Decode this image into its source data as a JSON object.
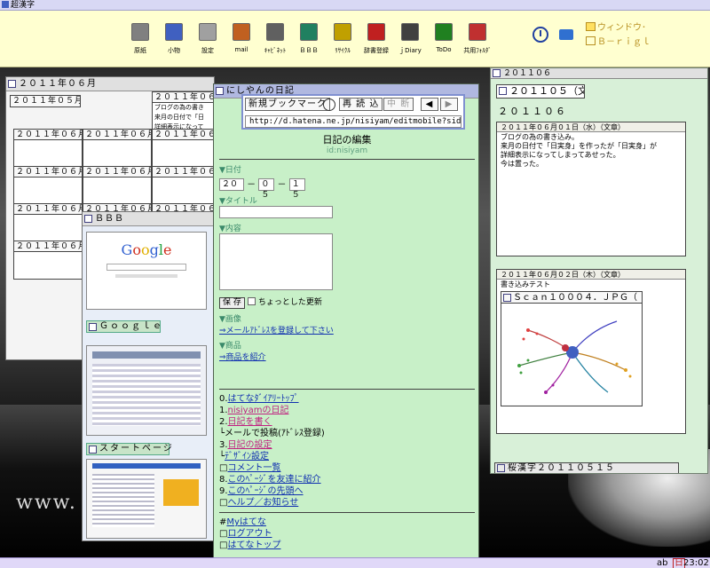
{
  "app": {
    "title": "超漢字"
  },
  "toolbar": {
    "items": [
      {
        "label": "原紙",
        "icon": "printer-icon",
        "color": "#808080"
      },
      {
        "label": "小物",
        "icon": "tools-icon",
        "color": "#4060c0"
      },
      {
        "label": "設定",
        "icon": "settings-icon",
        "color": "#a0a0a0"
      },
      {
        "label": "mail",
        "icon": "mail-icon",
        "color": "#c06020"
      },
      {
        "label": "ｷｬﾋﾞﾈｯﾄ",
        "icon": "cabinet-icon",
        "color": "#606060"
      },
      {
        "label": "ＢＢＢ",
        "icon": "bbb-icon",
        "color": "#208060"
      },
      {
        "label": "ﾘｻｲｸﾙ",
        "icon": "recycle-icon",
        "color": "#c0a000"
      },
      {
        "label": "辞書登録",
        "icon": "dictionary-icon",
        "color": "#c02020"
      },
      {
        "label": "ｊDiary",
        "icon": "diary-icon",
        "color": "#404040"
      },
      {
        "label": "ToDo",
        "icon": "todo-icon",
        "color": "#208020"
      },
      {
        "label": "共用ﾌｫﾙﾀﾞ",
        "icon": "shared-folder-icon",
        "color": "#c03030"
      }
    ],
    "window_label": "ウィンドウ･",
    "bright_label": "Ｂ－ｒｉｇｌ"
  },
  "calendar": {
    "title": "２０１１年０６月",
    "sub_title": "２０１１年０５月",
    "cells": [
      [
        "２０１１年０６月０",
        "ブログの為の書き",
        "来月の日付で「日",
        "詳細表示になって"
      ],
      [
        "２０１１年０６月０６"
      ],
      [
        "２０１１年０６月０７"
      ],
      [
        "２０１１年０６月０８"
      ],
      [
        "２０１１年０６月１３"
      ],
      [
        "２０１１年０６月１４"
      ],
      [
        "２０１１年０６月１５"
      ],
      [
        "２０１１年０６月２０"
      ],
      [
        "２０１１年０６月２１"
      ],
      [
        "２０１１年０６月２２"
      ],
      [
        "２０１１年０６月２７"
      ]
    ]
  },
  "bbb": {
    "title": "ＢＢＢ",
    "google_label": "Ｇｏｏｇｌｅ",
    "startpage_label": "スタートページ",
    "google_logo": "Google"
  },
  "bookmark": {
    "new_bookmark": "新規ブックマーク",
    "reload": "再 読 込",
    "stop": "中 断",
    "url": "http://d.hatena.ne.jp/nisiyam/editmobile?sid=21"
  },
  "diary": {
    "title": "にしやんの日記",
    "heading": "日記の編集",
    "user_id": "id:nisiyam",
    "date_label": "▼日付",
    "year": "２０",
    "month": "０５",
    "day": "１５",
    "title_label": "▼タイトル",
    "content_label": "▼内容",
    "save": "保 存",
    "small_update": "ちょっとした更新",
    "image_label": "▼画像",
    "mail_register": "⇒メールｱﾄﾞﾚｽを登録して下さい",
    "product_label": "▼商品",
    "product_intro": "⇒商品を紹介",
    "menu": [
      {
        "prefix": "0.",
        "text": "はてなﾀﾞｲｱﾘｰﾄｯﾌﾟ",
        "style": "lnk"
      },
      {
        "prefix": "1.",
        "text": "nisiyamの日記",
        "style": "pink"
      },
      {
        "prefix": "2.",
        "text": "日記を書く",
        "style": "pink"
      },
      {
        "prefix": "└",
        "text": "メールで投稿(ｱﾄﾞﾚｽ登録)",
        "style": "plain"
      },
      {
        "prefix": "3.",
        "text": "日記の設定",
        "style": "pink"
      },
      {
        "prefix": "└",
        "text": "ﾃﾞｻﾞｲﾝ設定",
        "style": "lnk"
      },
      {
        "prefix": "□",
        "text": "コメント一覧",
        "style": "lnk"
      },
      {
        "prefix": "8.",
        "text": "このﾍﾟｰｼﾞを友達に紹介",
        "style": "lnk"
      },
      {
        "prefix": "9.",
        "text": "このﾍﾟｰｼﾞの先頭へ",
        "style": "lnk"
      },
      {
        "prefix": "□",
        "text": "ヘルプ／お知らせ",
        "style": "lnk"
      }
    ],
    "footer": [
      {
        "prefix": "#",
        "text": "Myはてな"
      },
      {
        "prefix": "□",
        "text": "ログアウト"
      },
      {
        "prefix": "□",
        "text": "はてなトップ"
      }
    ]
  },
  "right_panel": {
    "header": "２０１１０６",
    "folder_label": "２０１１０５（文",
    "sub_label": "２０１１０６",
    "entry1_title": "２０１１年０６月０１日（水）（文章）",
    "entry1_lines": [
      "ブログの為の書き込み。",
      "来月の日付で「日実身」を作ったが「日実身」が",
      "詳細表示になってしまってあせった。",
      "今は置った。"
    ],
    "entry2_title": "２０１１年０６月０２日（木）（文章）",
    "entry2_line": "書き込みテスト",
    "scan_label": "Ｓｃａｎ１０００４．ＪＰＧ（",
    "bottom_label": "桜漢字２０１１０５１５"
  },
  "desktop": {
    "watermark": "www. fe"
  },
  "taskbar": {
    "ab": "ab",
    "day": "日",
    "time": "23:02"
  }
}
